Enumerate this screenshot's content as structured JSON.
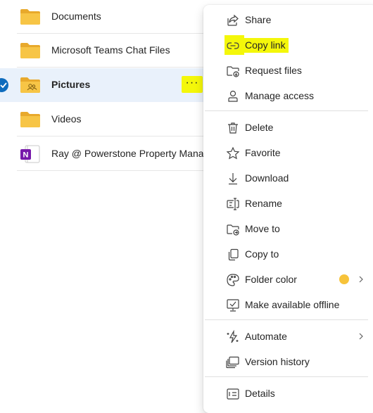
{
  "files": [
    {
      "name": "Documents",
      "type": "folder",
      "selected": false
    },
    {
      "name": "Microsoft Teams Chat Files",
      "type": "folder",
      "selected": false
    },
    {
      "name": "Pictures",
      "type": "shared-folder",
      "selected": true
    },
    {
      "name": "Videos",
      "type": "folder",
      "selected": false
    },
    {
      "name": "Ray @ Powerstone Property Manag",
      "type": "onenote",
      "selected": false
    }
  ],
  "more_button": {
    "label": "···"
  },
  "menu": {
    "items": [
      {
        "label": "Share",
        "icon": "share-icon"
      },
      {
        "label": "Copy link",
        "icon": "link-icon",
        "highlighted": true
      },
      {
        "label": "Request files",
        "icon": "folder-request-icon"
      },
      {
        "label": "Manage access",
        "icon": "person-icon"
      },
      {
        "label": "Delete",
        "icon": "trash-icon"
      },
      {
        "label": "Favorite",
        "icon": "star-icon"
      },
      {
        "label": "Download",
        "icon": "download-icon"
      },
      {
        "label": "Rename",
        "icon": "rename-icon"
      },
      {
        "label": "Move to",
        "icon": "folder-move-icon"
      },
      {
        "label": "Copy to",
        "icon": "copy-icon"
      },
      {
        "label": "Folder color",
        "icon": "palette-icon",
        "has_submenu": true
      },
      {
        "label": "Make available offline",
        "icon": "offline-icon"
      },
      {
        "label": "Automate",
        "icon": "automate-icon",
        "has_submenu": true
      },
      {
        "label": "Version history",
        "icon": "version-history-icon"
      },
      {
        "label": "Details",
        "icon": "details-icon"
      }
    ]
  },
  "colors": {
    "folder": "#f7c546",
    "selection": "#e9f1fb",
    "highlight": "#f4f70a",
    "check": "#0f6cbd",
    "folder_color_dot": "#f7c33a",
    "onenote": "#7719aa"
  }
}
